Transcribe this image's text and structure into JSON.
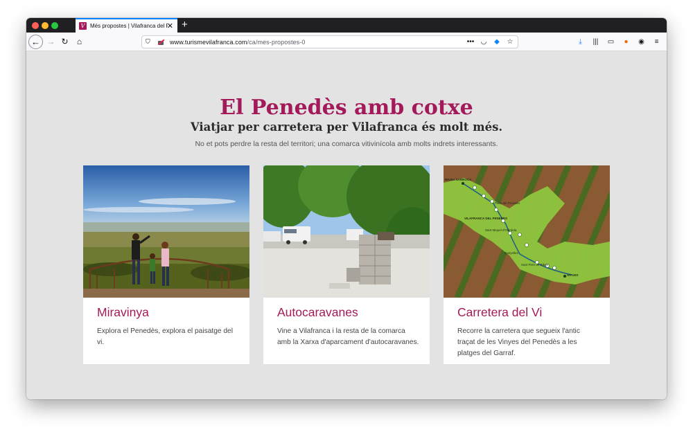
{
  "browser": {
    "tab_title": "Més propostes | Vilafranca del Penedès",
    "tab_favicon_letter": "V",
    "url_host": "www.turismevilafranca.com",
    "url_path": "/ca/mes-propostes-0"
  },
  "page": {
    "heading": "El Penedès amb cotxe",
    "subheading": "Viatjar per carretera per Vilafranca és molt més.",
    "intro": "No et pots perdre la resta del territori; una comarca vitivinícola amb molts indrets interessants.",
    "accent_color": "#a4195a"
  },
  "cards": [
    {
      "title": "Miravinya",
      "text": "Explora el Penedès, explora el paisatge del vi.",
      "image_alt": "Family on a viewpoint overlooking vineyards"
    },
    {
      "title": "Autocaravanes",
      "text": "Vine a Vilafranca i la resta de la comarca amb la Xarxa d'aparcament d'autocaravanes.",
      "image_alt": "Motorhomes parked under trees with a service point"
    },
    {
      "title": "Carretera del Vi",
      "text": "Recorre la carretera que segueix l'antic traçat de les Vinyes del Penedès a les platges del Garraf.",
      "image_alt": "Map of the wine road over vineyards",
      "map_labels": [
        "MASIA SARROCA",
        "Pacs del Penedès",
        "VILAFRANCA DEL PENEDÈS",
        "Sant Miquel d'Olèrdola",
        "Canyelles",
        "Sant Pere de Ribes",
        "SITGES"
      ]
    }
  ]
}
